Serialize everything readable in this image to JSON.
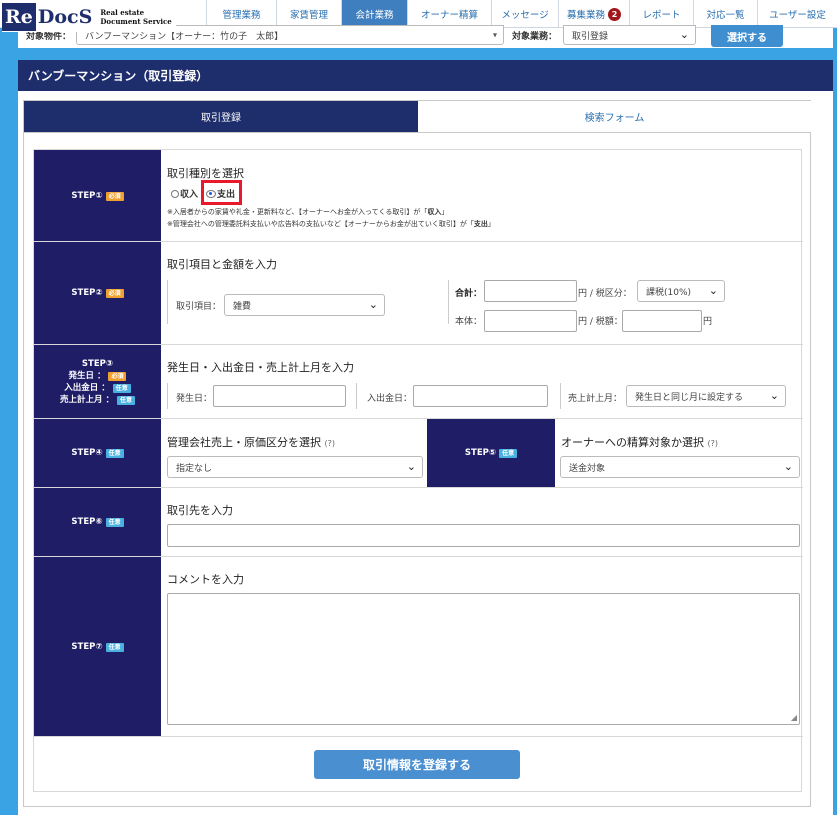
{
  "header": {
    "logo_re": "Re",
    "logo_docs": "DocS",
    "logo_sub1": "Real estate",
    "logo_sub2": "Document Service",
    "nav": [
      {
        "label": "管理業務",
        "active": false,
        "badge": ""
      },
      {
        "label": "家賃管理",
        "active": false,
        "badge": ""
      },
      {
        "label": "会計業務",
        "active": true,
        "badge": ""
      },
      {
        "label": "オーナー精算",
        "active": false,
        "badge": ""
      },
      {
        "label": "メッセージ",
        "active": false,
        "badge": ""
      },
      {
        "label": "募集業務",
        "active": false,
        "badge": "2"
      },
      {
        "label": "レポート",
        "active": false,
        "badge": ""
      },
      {
        "label": "対応一覧",
        "active": false,
        "badge": ""
      },
      {
        "label": "ユーザー設定",
        "active": false,
        "badge": ""
      }
    ]
  },
  "filter": {
    "property_label": "対象物件：",
    "property_value": "バンブーマンション【オーナー：竹の子　太郎】",
    "work_label": "対象業務：",
    "work_value": "取引登録",
    "select_button": "選択する"
  },
  "panel": {
    "title": "バンブーマンション（取引登録）",
    "tabs": [
      "取引登録",
      "検索フォーム"
    ]
  },
  "tags": {
    "required": "必須",
    "optional": "任意"
  },
  "step1": {
    "step": "STEP①",
    "heading": "取引種別を選択",
    "income": "収入",
    "expense": "支出",
    "note1_a": "※入居者からの家賃や礼金・更新料など、【オーナーへお金が入ってくる取引】が「",
    "note1_b": "収入",
    "note1_c": "」",
    "note2_a": "※管理会社への管理委託料支払いや広告料の支払いなど【オーナーからお金が出ていく取引】が「",
    "note2_b": "支出",
    "note2_c": "」"
  },
  "step2": {
    "step": "STEP②",
    "heading": "取引項目と金額を入力",
    "item_label": "取引項目：",
    "item_value": "雑費",
    "total_label": "合計：",
    "yen_tax_label": "円 / 税区分：",
    "tax_value": "課税(10%)",
    "base_label": "本体：",
    "yen_taxamt_label": "円 / 税額：",
    "yen": "円"
  },
  "step3": {
    "step": "STEP③",
    "line1": "発生日 ：",
    "line2": "入出金日 ：",
    "line3": "売上計上月 ：",
    "heading": "発生日・入出金日・売上計上月を入力",
    "occur_label": "発生日：",
    "inout_label": "入出金日：",
    "month_label": "売上計上月：",
    "month_value": "発生日と同じ月に設定する"
  },
  "step4": {
    "step": "STEP④",
    "heading": "管理会社売上・原価区分を選択",
    "help": "(?)",
    "value": "指定なし"
  },
  "step5": {
    "step": "STEP⑤",
    "heading": "オーナーへの精算対象か選択",
    "help": "(?)",
    "value": "送金対象"
  },
  "step6": {
    "step": "STEP⑥",
    "heading": "取引先を入力"
  },
  "step7": {
    "step": "STEP⑦",
    "heading": "コメントを入力"
  },
  "submit_label": "取引情報を登録する",
  "colors": {
    "navy": "#1e2d6b",
    "accent": "#3f7fbf",
    "background": "#3aa3e3",
    "highlight": "#e8192c"
  }
}
